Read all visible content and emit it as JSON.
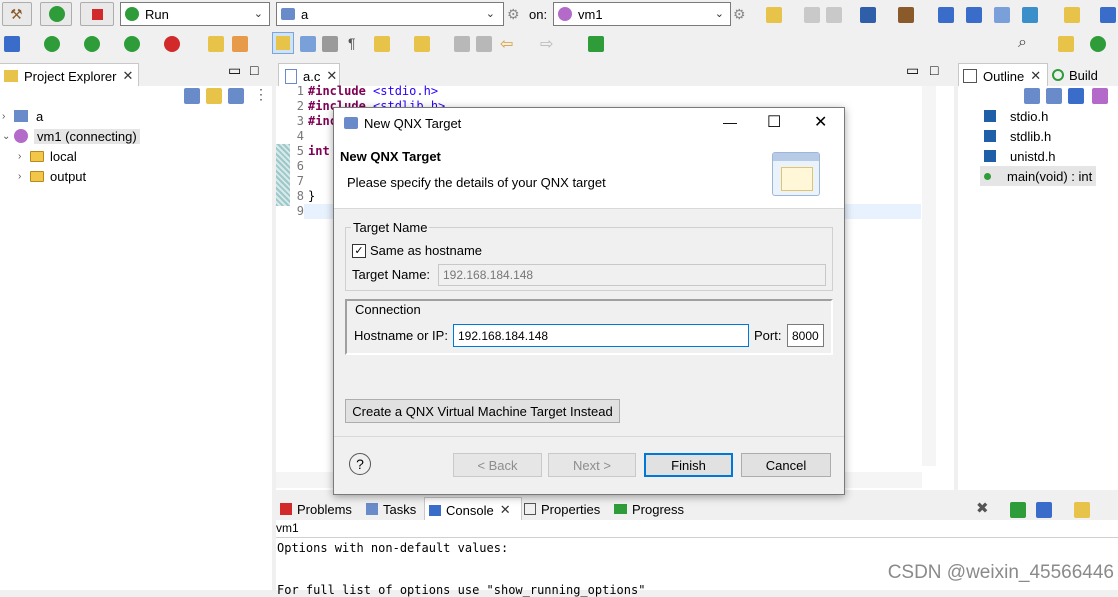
{
  "toolbar": {
    "run_mode": "Run",
    "launch_config": "a",
    "on_label": "on:",
    "target": "vm1"
  },
  "project_explorer": {
    "title": "Project Explorer",
    "items": [
      {
        "label": "a"
      },
      {
        "label": "vm1 (connecting)"
      },
      {
        "label": "local"
      },
      {
        "label": "output"
      }
    ]
  },
  "editor": {
    "tab": "a.c",
    "line_numbers": [
      "1",
      "2",
      "3",
      "4",
      "5",
      "6",
      "7",
      "8",
      "9"
    ],
    "lines": [
      "#include <stdio.h>",
      "#include <stdlib.h>",
      "#inc",
      "",
      "int",
      "",
      "",
      "}",
      ""
    ]
  },
  "outline": {
    "title": "Outline",
    "build_tab": "Build",
    "items": [
      "stdio.h",
      "stdlib.h",
      "unistd.h",
      "main(void) : int"
    ]
  },
  "dialog": {
    "window_title": "New QNX Target",
    "header_title": "New QNX Target",
    "header_desc": "Please specify the details of your QNX target",
    "group_target": "Target Name",
    "same_as_hostname": "Same as hostname",
    "target_name_label": "Target Name:",
    "target_name_value": "192.168.184.148",
    "group_connection": "Connection",
    "hostname_label": "Hostname or IP:",
    "hostname_value": "192.168.184.148",
    "port_label": "Port:",
    "port_value": "8000",
    "vm_button": "Create a QNX Virtual Machine Target Instead",
    "help": "?",
    "back": "< Back",
    "next": "Next >",
    "finish": "Finish",
    "cancel": "Cancel"
  },
  "bottom": {
    "tabs": [
      "Problems",
      "Tasks",
      "Console",
      "Properties",
      "Progress"
    ],
    "console_name": "vm1",
    "console_lines": [
      "Options with non-default values:",
      "",
      "For full list of options use \"show_running_options\""
    ]
  },
  "watermark": "CSDN @weixin_45566446"
}
